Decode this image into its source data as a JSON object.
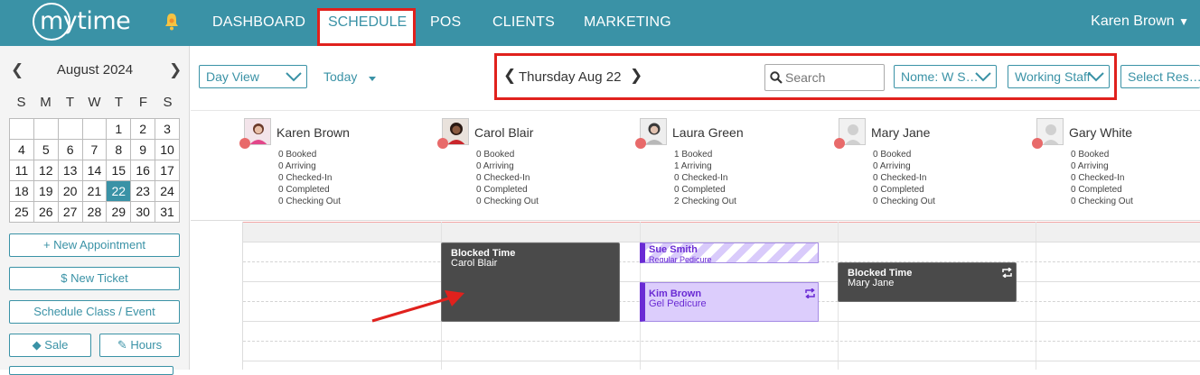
{
  "app": {
    "logo_text": "mytime",
    "brand_color": "#3a92a6",
    "accent_color": "#e0211d"
  },
  "nav": {
    "items": [
      "DASHBOARD",
      "SCHEDULE",
      "POS",
      "CLIENTS",
      "MARKETING"
    ],
    "active": "SCHEDULE",
    "user": "Karen Brown"
  },
  "calendar": {
    "month_label": "August 2024",
    "weekdays": [
      "S",
      "M",
      "T",
      "W",
      "T",
      "F",
      "S"
    ],
    "weeks": [
      [
        "",
        "",
        "",
        "",
        "1",
        "2",
        "3"
      ],
      [
        "4",
        "5",
        "6",
        "7",
        "8",
        "9",
        "10"
      ],
      [
        "11",
        "12",
        "13",
        "14",
        "15",
        "16",
        "17"
      ],
      [
        "18",
        "19",
        "20",
        "21",
        "22",
        "23",
        "24"
      ],
      [
        "25",
        "26",
        "27",
        "28",
        "29",
        "30",
        "31"
      ]
    ],
    "selected_day": "22"
  },
  "left_buttons": {
    "new_appointment": "+ New Appointment",
    "new_ticket": "$  New Ticket",
    "schedule_class": "Schedule Class / Event",
    "sale": "Sale",
    "hours": "Hours"
  },
  "toolbar": {
    "view_select": "Day View",
    "today": "Today",
    "date_dow": "Thursday",
    "date_md": "Aug 22",
    "search_placeholder": "Search",
    "location_select": "Nome: W S…",
    "staff_select": "Working Staff",
    "resource_select": "Select Res…"
  },
  "staff": [
    {
      "name": "Karen Brown",
      "avatar": "photo-woman-pink-icon",
      "stats": [
        "0 Booked",
        "0 Arriving",
        "0 Checked-In",
        "0 Completed",
        "0 Checking Out"
      ]
    },
    {
      "name": "Carol Blair",
      "avatar": "photo-woman-red-icon",
      "stats": [
        "0 Booked",
        "0 Arriving",
        "0 Checked-In",
        "0 Completed",
        "0 Checking Out"
      ]
    },
    {
      "name": "Laura Green",
      "avatar": "photo-woman-gray-icon",
      "stats": [
        "1 Booked",
        "1 Arriving",
        "0 Checked-In",
        "0 Completed",
        "2 Checking Out"
      ]
    },
    {
      "name": "Mary Jane",
      "avatar": "placeholder-person-icon",
      "stats": [
        "0 Booked",
        "0 Arriving",
        "0 Checked-In",
        "0 Completed",
        "0 Checking Out"
      ]
    },
    {
      "name": "Gary White",
      "avatar": "placeholder-person-icon",
      "stats": [
        "0 Booked",
        "0 Arriving",
        "0 Checked-In",
        "0 Completed",
        "0 Checking Out"
      ]
    }
  ],
  "appointments": {
    "carol_block": {
      "title": "Blocked Time",
      "sub": "Carol Blair"
    },
    "sue": {
      "title": "Sue Smith",
      "sub": "Regular Pedicure"
    },
    "kim": {
      "title": "Kim Brown",
      "sub": "Gel Pedicure"
    },
    "mary_block": {
      "title": "Blocked Time",
      "sub": "Mary Jane"
    }
  }
}
